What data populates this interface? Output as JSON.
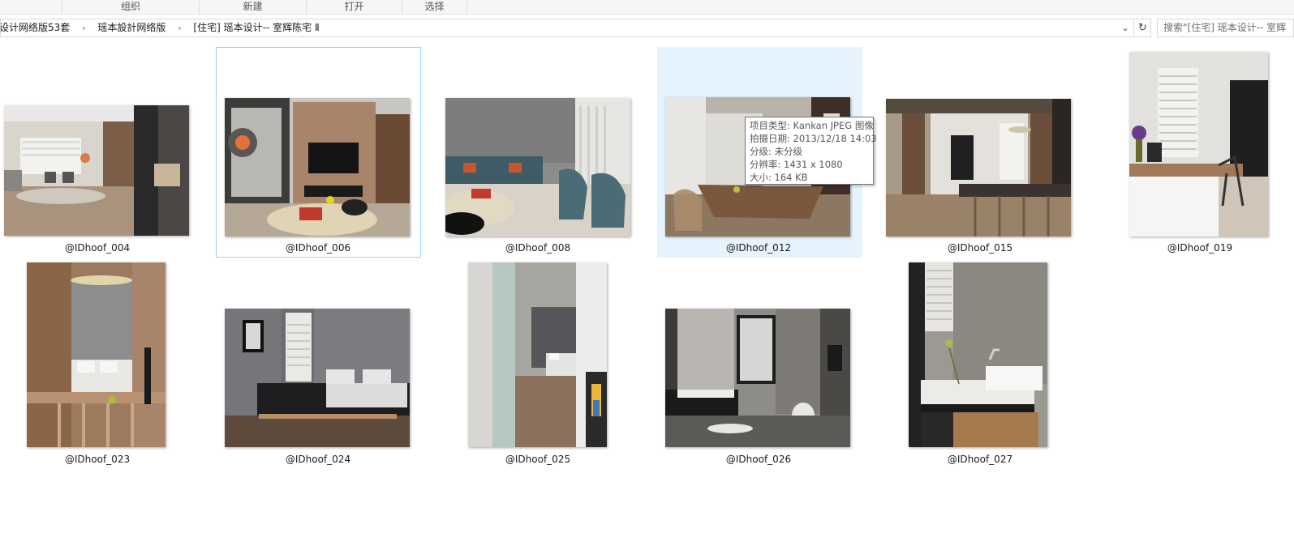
{
  "ribbon": {
    "groups": [
      "组织",
      "新建",
      "打开",
      "选择"
    ]
  },
  "address": {
    "crumbs": [
      "设计网络版53套",
      "瑶本設計网络版",
      "[住宅] 瑶本设计-- 室辉陈宅 Ⅱ"
    ],
    "separator": "›",
    "dropdown_icon": "chevron-down-icon",
    "refresh_icon": "refresh-icon"
  },
  "search": {
    "placeholder": "搜索\"[住宅] 瑶本设计-- 室辉"
  },
  "files": [
    {
      "name": "@IDhoof_004",
      "scene": "living-room",
      "selected": false,
      "hovered": false
    },
    {
      "name": "@IDhoof_006",
      "scene": "tv-wall",
      "selected": true,
      "hovered": false
    },
    {
      "name": "@IDhoof_008",
      "scene": "blue-sofa",
      "selected": false,
      "hovered": false
    },
    {
      "name": "@IDhoof_012",
      "scene": "dining-room",
      "selected": false,
      "hovered": true
    },
    {
      "name": "@IDhoof_015",
      "scene": "corridor-dining",
      "selected": false,
      "hovered": false
    },
    {
      "name": "@IDhoof_019",
      "scene": "study-desk",
      "selected": false,
      "hovered": false
    },
    {
      "name": "@IDhoof_023",
      "scene": "bedroom-pendant",
      "selected": false,
      "hovered": false
    },
    {
      "name": "@IDhoof_024",
      "scene": "bedroom",
      "selected": false,
      "hovered": false
    },
    {
      "name": "@IDhoof_025",
      "scene": "hallway-bedroom",
      "selected": false,
      "hovered": false
    },
    {
      "name": "@IDhoof_026",
      "scene": "bathroom",
      "selected": false,
      "hovered": false
    },
    {
      "name": "@IDhoof_027",
      "scene": "washbasin",
      "selected": false,
      "hovered": false
    }
  ],
  "tooltip": {
    "lines": [
      "项目类型: Kankan JPEG 图像",
      "拍摄日期: 2013/12/18 14:03",
      "分级: 未分级",
      "分辨率: 1431 x 1080",
      "大小: 164 KB"
    ]
  },
  "colors": {
    "selected_border": "#99d1ff",
    "hover_fill": "#e5f3ff",
    "address_border": "#d9d9d9"
  }
}
